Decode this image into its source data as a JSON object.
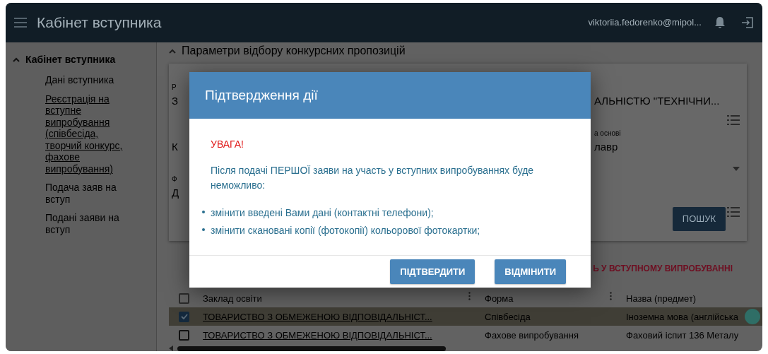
{
  "header": {
    "title": "Кабінет вступника",
    "user_email": "viktoriia.fedorenko@mipol..."
  },
  "sidebar": {
    "section": {
      "label": "Кабінет вступника",
      "expanded": true
    },
    "items": [
      {
        "label": "Дані вступника",
        "kind": "plain"
      },
      {
        "label": "Реєстрація на вступне випробування (співбесіда, творчий конкурс, фахове випробування)",
        "kind": "link"
      },
      {
        "label": "Подача заяв на вступ",
        "kind": "plain"
      },
      {
        "label": "Подані заяви на вступ",
        "kind": "plain"
      }
    ]
  },
  "content": {
    "section_title": "Параметри відбору конкурсних пропозицій",
    "expanded": true,
    "filter_rows": [
      {
        "label_left": "Р",
        "value_left": "З",
        "value_right": "АЛЬНІСТЮ \"ТЕХНІЧНИ...",
        "kind": "list"
      },
      {
        "label_right": "а основі",
        "value_left": "К",
        "value_right": "лавр",
        "kind": "select"
      },
      {
        "label_left": "Ф",
        "value_left": "Д",
        "kind": "list"
      }
    ],
    "search_button": "ПОШУК",
    "results_title": "Ь У ВСТУПНОМУ ВИПРОБУВАННІ"
  },
  "table": {
    "columns": [
      "Заклад освіти",
      "Форма",
      "Назва (предмет)"
    ],
    "all_selected": false,
    "rows": [
      {
        "selected": true,
        "cells": [
          "ТОВАРИСТВО З ОБМЕЖЕНОЮ ВІДПОВІДАЛЬНІСТ...",
          "Співбесіда",
          "Іноземна мова (англійська"
        ]
      },
      {
        "selected": false,
        "cells": [
          "ТОВАРИСТВО З ОБМЕЖЕНОЮ ВІДПОВІДАЛЬНІСТ...",
          "Фахове випробування",
          "Фаховий іспит 136 Металу"
        ]
      }
    ]
  },
  "modal": {
    "title": "Підтвердження дії",
    "warning": "УВАГА!",
    "message": "Після подачі ПЕРШОЇ заяви на участь у вступних випробуваннях буде неможливо:",
    "bullets": [
      "змінити введені Вами дані (контактні телефони);",
      "змінити скановані копії (фотокопії) кольорової фотокартки;"
    ],
    "buttons": [
      "ПІДТВЕРДИТИ",
      "ВІДМІНИТИ"
    ]
  }
}
